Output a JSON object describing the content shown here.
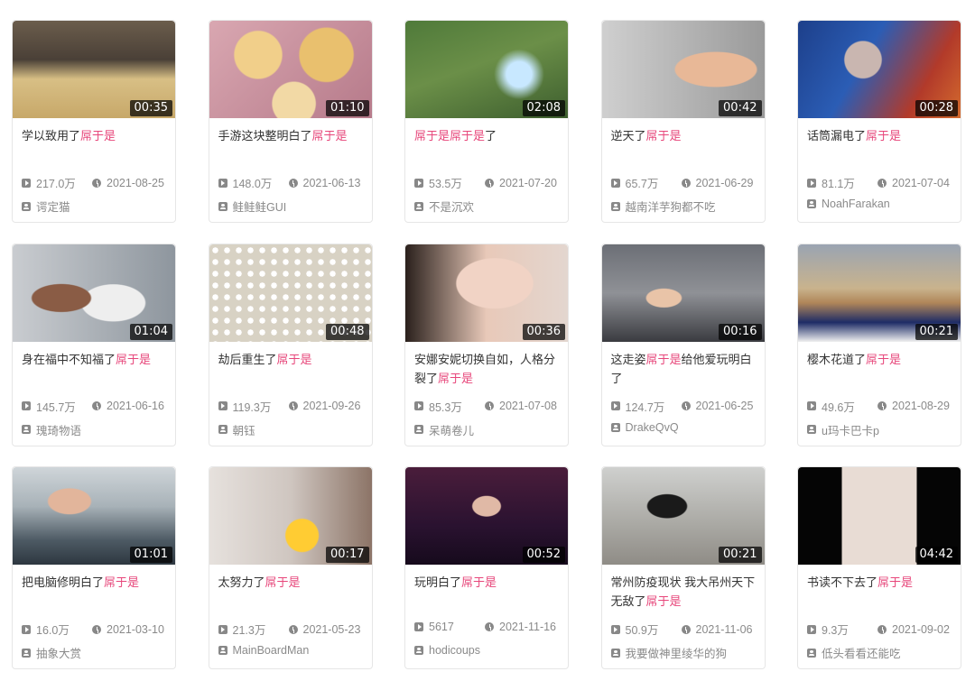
{
  "videos": [
    {
      "title": "学以致用了",
      "highlight": "屌于是",
      "duration": "00:35",
      "views": "217.0万",
      "date": "2021-08-25",
      "author": "谔定猫",
      "bg": "linear-gradient(180deg,#6b5d4c 0%,#4a4037 40%,#d8bf85 60%,#c7a869 100%)"
    },
    {
      "title": "手游这块整明白了",
      "highlight": "屌于是",
      "duration": "01:10",
      "views": "148.0万",
      "date": "2021-06-13",
      "author": "鲑鲑鲑GUI",
      "bg": "radial-gradient(circle at 30% 35%,#f1cf8a 0 18%,transparent 19%),radial-gradient(circle at 72% 35%,#e9c06e 0 20%,transparent 21%),radial-gradient(circle at 52% 85%,#f2d9a5 0 18%,transparent 19%),linear-gradient(135deg,#d9a7b1,#b67a8a)"
    },
    {
      "title": "",
      "highlight": "屌于是屌于是",
      "suffix": "了",
      "duration": "02:08",
      "views": "53.5万",
      "date": "2021-07-20",
      "author": "不是沉欢",
      "bg": "radial-gradient(circle at 70% 55%,#c8e8ff 0 10%,transparent 20%),linear-gradient(160deg,#4f7a3a 0%,#6b8f48 45%,#3d5e2e 100%)"
    },
    {
      "title": "逆天了",
      "highlight": "屌于是",
      "duration": "00:42",
      "views": "65.7万",
      "date": "2021-06-29",
      "author": "越南洋芋狗都不吃",
      "bg": "radial-gradient(ellipse at 70% 50%,#e8b897 0 25%,transparent 26%),linear-gradient(90deg,#cfcfcf,#9a9a9a)"
    },
    {
      "title": "话筒漏电了",
      "highlight": "屌于是",
      "duration": "00:28",
      "views": "81.1万",
      "date": "2021-07-04",
      "author": "NoahFarakan",
      "bg": "radial-gradient(circle at 40% 40%,#c9b6b0 0 16%,transparent 17%),linear-gradient(120deg,#1d3f8a 0%,#2b5db5 40%,#b23a2a 75%,#d46b2e 100%)"
    },
    {
      "title": "身在福中不知福了",
      "highlight": "屌于是",
      "duration": "01:04",
      "views": "145.7万",
      "date": "2021-06-16",
      "author": "瑰琦物语",
      "bg": "radial-gradient(ellipse at 30% 55%,#8a5c45 0 18%,transparent 19%),radial-gradient(ellipse at 62% 60%,#eeeeee 0 22%,transparent 23%),linear-gradient(90deg,#c9ccd0,#8e969e)"
    },
    {
      "title": "劫后重生了",
      "highlight": "屌于是",
      "duration": "00:48",
      "views": "119.3万",
      "date": "2021-09-26",
      "author": "朝钰",
      "bg": "radial-gradient(circle,#ffffff 0 35%,transparent 36%) 0 0/13px 13px,linear-gradient(#d8d2c4,#d8d2c4)"
    },
    {
      "title": "安娜安妮切换自如，人格分裂了",
      "highlight": "屌于是",
      "duration": "00:36",
      "views": "85.3万",
      "date": "2021-07-08",
      "author": "呆萌卷儿",
      "bg": "radial-gradient(ellipse at 55% 40%,#f1d3c5 0 30%,transparent 31%),linear-gradient(90deg,#2a201c,#e8c9b9 50%,#e3d6cf)"
    },
    {
      "title": "这走姿",
      "highlight": "屌于是",
      "suffix": "给他爱玩明白了",
      "duration": "00:16",
      "views": "124.7万",
      "date": "2021-06-25",
      "author": "DrakeQvQ",
      "bg": "radial-gradient(ellipse at 38% 55%,#e9c4a8 0 12%,transparent 13%),linear-gradient(180deg,#6c6f76 0%,#8f9196 50%,#3a3b40 100%)"
    },
    {
      "title": "樱木花道了",
      "highlight": "屌于是",
      "duration": "00:21",
      "views": "49.6万",
      "date": "2021-08-29",
      "author": "u玛卡巴卡p",
      "bg": "linear-gradient(180deg,#9aa4b2 0%,#c9b38d 45%,#b08659 60%,#1e2c66 80%,#f0f0f0 100%)"
    },
    {
      "title": "把电脑修明白了",
      "highlight": "屌于是",
      "duration": "01:01",
      "views": "16.0万",
      "date": "2021-03-10",
      "author": "抽象大赏",
      "bg": "radial-gradient(ellipse at 35% 35%,#e2b59b 0 14%,transparent 15%),linear-gradient(180deg,#cfd5d9 0%,#a8b2b8 40%,#4d5a64 75%,#2d3740 100%)"
    },
    {
      "title": "太努力了",
      "highlight": "屌于是",
      "duration": "00:17",
      "views": "21.3万",
      "date": "2021-05-23",
      "author": "MainBoardMan",
      "bg": "radial-gradient(circle at 57% 70%,#ffcc33 0 14%,transparent 15%),linear-gradient(90deg,#e6e1dd,#cfc6c0 50%,#8c7467)"
    },
    {
      "title": "玩明白了",
      "highlight": "屌于是",
      "duration": "00:52",
      "views": "5617",
      "date": "2021-11-16",
      "author": "hodicoups",
      "bg": "radial-gradient(ellipse at 50% 40%,#e0b9a6 0 12%,transparent 13%),linear-gradient(180deg,#4a1d3b 0%,#2a1230 60%,#160a1c 100%)"
    },
    {
      "title": "常州防疫现状 我大吊州天下无敌了",
      "highlight": "屌于是",
      "duration": "00:21",
      "views": "50.9万",
      "date": "2021-11-06",
      "author": "我要做神里绫华的狗",
      "bg": "radial-gradient(ellipse at 40% 40%,#1a1a1a 0 14%,transparent 15%),linear-gradient(180deg,#cfd0ce 0%,#a9a8a3 60%,#8f8c86 100%)"
    },
    {
      "title": "书读不下去了",
      "highlight": "屌于是",
      "duration": "04:42",
      "views": "9.3万",
      "date": "2021-09-02",
      "author": "低头看看还能吃",
      "bg": "linear-gradient(90deg,#050505 0 27%,#e8dcd4 27% 73%,#050505 73%)"
    }
  ]
}
